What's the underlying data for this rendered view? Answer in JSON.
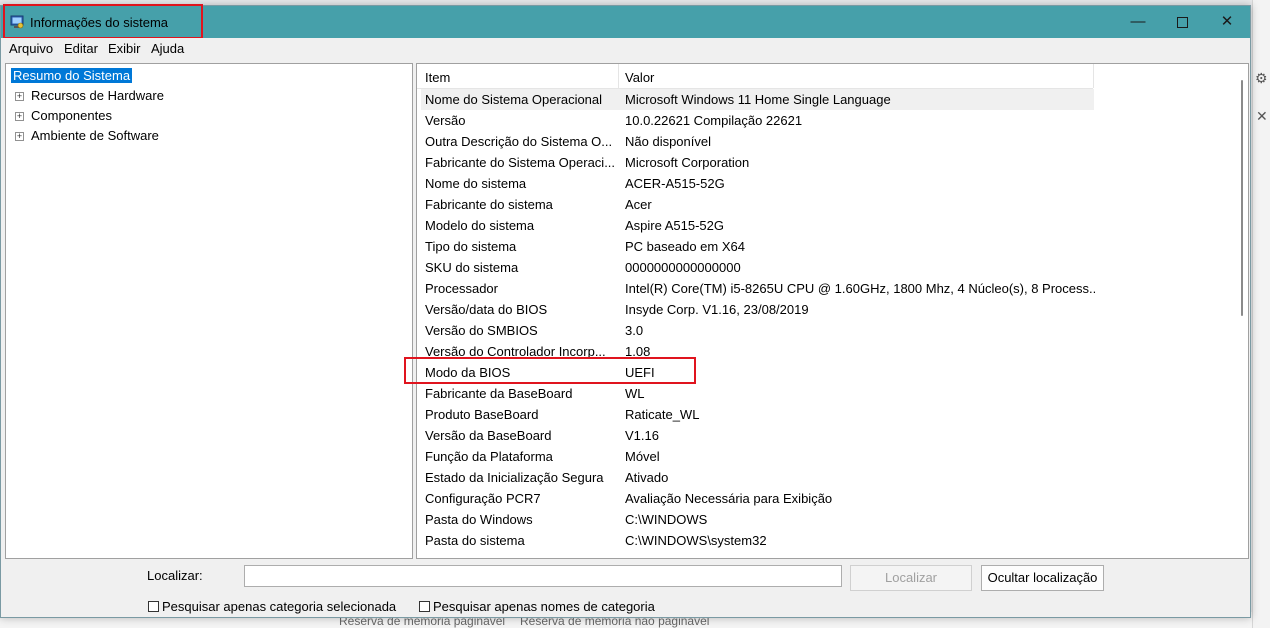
{
  "window": {
    "title": "Informações do sistema",
    "min_icon": "minimize-icon",
    "max_icon": "maximize-icon",
    "close_icon": "close-icon"
  },
  "menu": [
    "Arquivo",
    "Editar",
    "Exibir",
    "Ajuda"
  ],
  "tree": [
    {
      "label": "Resumo do Sistema",
      "selected": true,
      "expandable": false
    },
    {
      "label": "Recursos de Hardware",
      "selected": false,
      "expandable": true
    },
    {
      "label": "Componentes",
      "selected": false,
      "expandable": true
    },
    {
      "label": "Ambiente de Software",
      "selected": false,
      "expandable": true
    }
  ],
  "list": {
    "columns": [
      "Item",
      "Valor"
    ],
    "rows": [
      [
        "Nome do Sistema Operacional",
        "Microsoft Windows 11 Home Single Language"
      ],
      [
        "Versão",
        "10.0.22621 Compilação 22621"
      ],
      [
        "Outra Descrição do Sistema O...",
        "Não disponível"
      ],
      [
        "Fabricante do Sistema Operaci...",
        "Microsoft Corporation"
      ],
      [
        "Nome do sistema",
        "ACER-A515-52G"
      ],
      [
        "Fabricante do sistema",
        "Acer"
      ],
      [
        "Modelo do sistema",
        "Aspire A515-52G"
      ],
      [
        "Tipo do sistema",
        "PC baseado em X64"
      ],
      [
        "SKU do sistema",
        "0000000000000000"
      ],
      [
        "Processador",
        "Intel(R) Core(TM) i5-8265U CPU @ 1.60GHz, 1800 Mhz, 4 Núcleo(s), 8 Process..."
      ],
      [
        "Versão/data do BIOS",
        "Insyde Corp. V1.16, 23/08/2019"
      ],
      [
        "Versão do SMBIOS",
        "3.0"
      ],
      [
        "Versão do Controlador Incorp...",
        "1.08"
      ],
      [
        "Modo da BIOS",
        "UEFI"
      ],
      [
        "Fabricante da BaseBoard",
        "WL"
      ],
      [
        "Produto BaseBoard",
        "Raticate_WL"
      ],
      [
        "Versão da BaseBoard",
        "V1.16"
      ],
      [
        "Função da Plataforma",
        "Móvel"
      ],
      [
        "Estado da Inicialização Segura",
        "Ativado"
      ],
      [
        "Configuração PCR7",
        "Avaliação Necessária para Exibição"
      ],
      [
        "Pasta do Windows",
        "C:\\WINDOWS"
      ],
      [
        "Pasta do sistema",
        "C:\\WINDOWS\\system32"
      ]
    ]
  },
  "search": {
    "label": "Localizar:",
    "value": "",
    "find_button": "Localizar",
    "hide_button": "Ocultar localização",
    "check_selected_category": "Pesquisar apenas categoria selecionada",
    "check_category_names": "Pesquisar apenas nomes de categoria"
  },
  "background": {
    "bottom_left": "Reserva de memória paginável",
    "bottom_right": "Reserva de memória não paginável"
  },
  "colors": {
    "titlebar": "#46a0aa",
    "selection": "#0078d7",
    "highlight_box": "#e0141e"
  }
}
